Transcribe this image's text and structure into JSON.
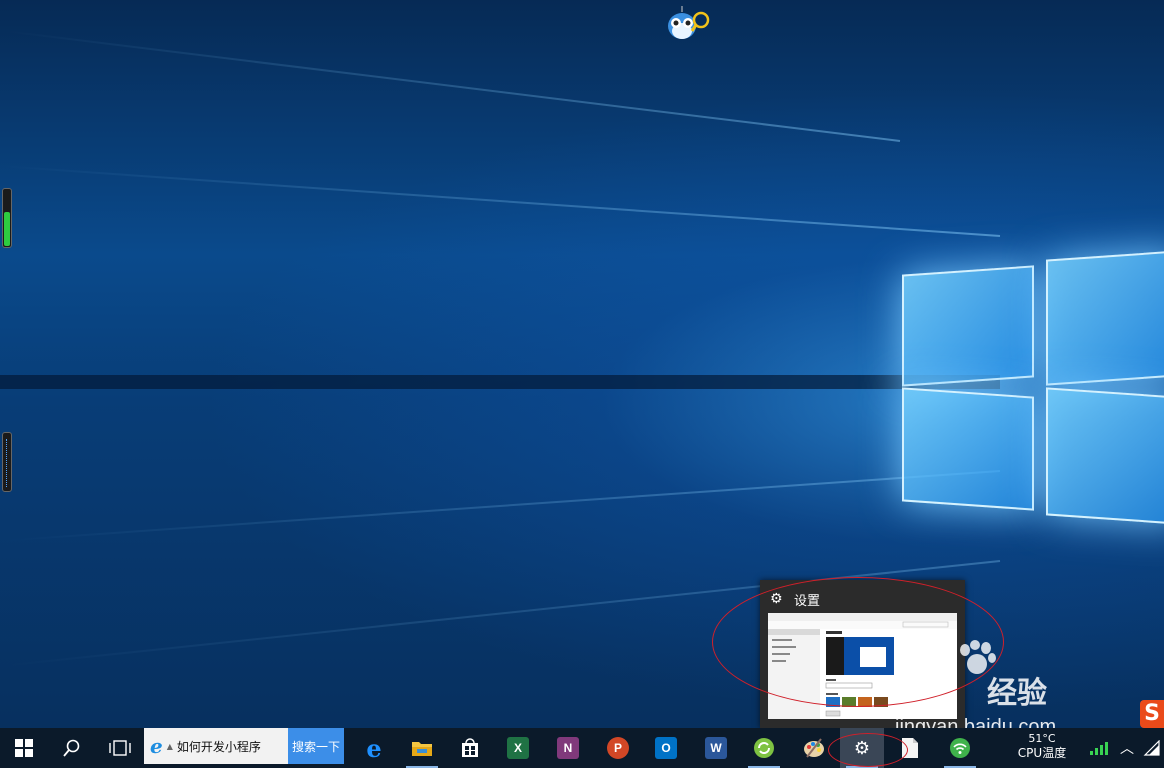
{
  "desktop": {
    "wallpaper": "windows-10-hero",
    "accent_color": "#1f8fff"
  },
  "taskbar": {
    "start_icon": "windows-logo-icon",
    "search_icon": "search-icon",
    "task_view_icon": "task-view-icon",
    "search_box": {
      "value": "如何开发小程序",
      "button_label": "搜索一下"
    },
    "apps": [
      {
        "name": "edge",
        "icon": "edge-icon"
      },
      {
        "name": "file-explorer",
        "icon": "folder-icon"
      },
      {
        "name": "store",
        "icon": "store-icon"
      },
      {
        "name": "excel",
        "icon": "excel-icon",
        "letter": "X",
        "color": "#1f7244"
      },
      {
        "name": "onenote",
        "icon": "onenote-icon",
        "letter": "N",
        "color": "#80397b"
      },
      {
        "name": "powerpoint",
        "icon": "powerpoint-icon",
        "letter": "P",
        "color": "#d24726"
      },
      {
        "name": "outlook",
        "icon": "outlook-icon",
        "letter": "O",
        "color": "#0072c6"
      },
      {
        "name": "word",
        "icon": "word-icon",
        "letter": "W",
        "color": "#2b579a"
      },
      {
        "name": "refresh-app",
        "icon": "refresh-icon"
      },
      {
        "name": "paint",
        "icon": "palette-icon"
      },
      {
        "name": "settings",
        "icon": "gear-icon"
      },
      {
        "name": "notepad",
        "icon": "document-icon"
      },
      {
        "name": "wifi-app",
        "icon": "wifi-icon"
      }
    ],
    "tray": {
      "temperature": "51°C",
      "temperature_label": "CPU温度"
    }
  },
  "preview": {
    "title": "设置",
    "icon": "gear-icon"
  },
  "watermark": {
    "logo_text": "Bai",
    "site_name": "经验",
    "url": "jingyan.baidu.com"
  },
  "sogou_badge": "S"
}
